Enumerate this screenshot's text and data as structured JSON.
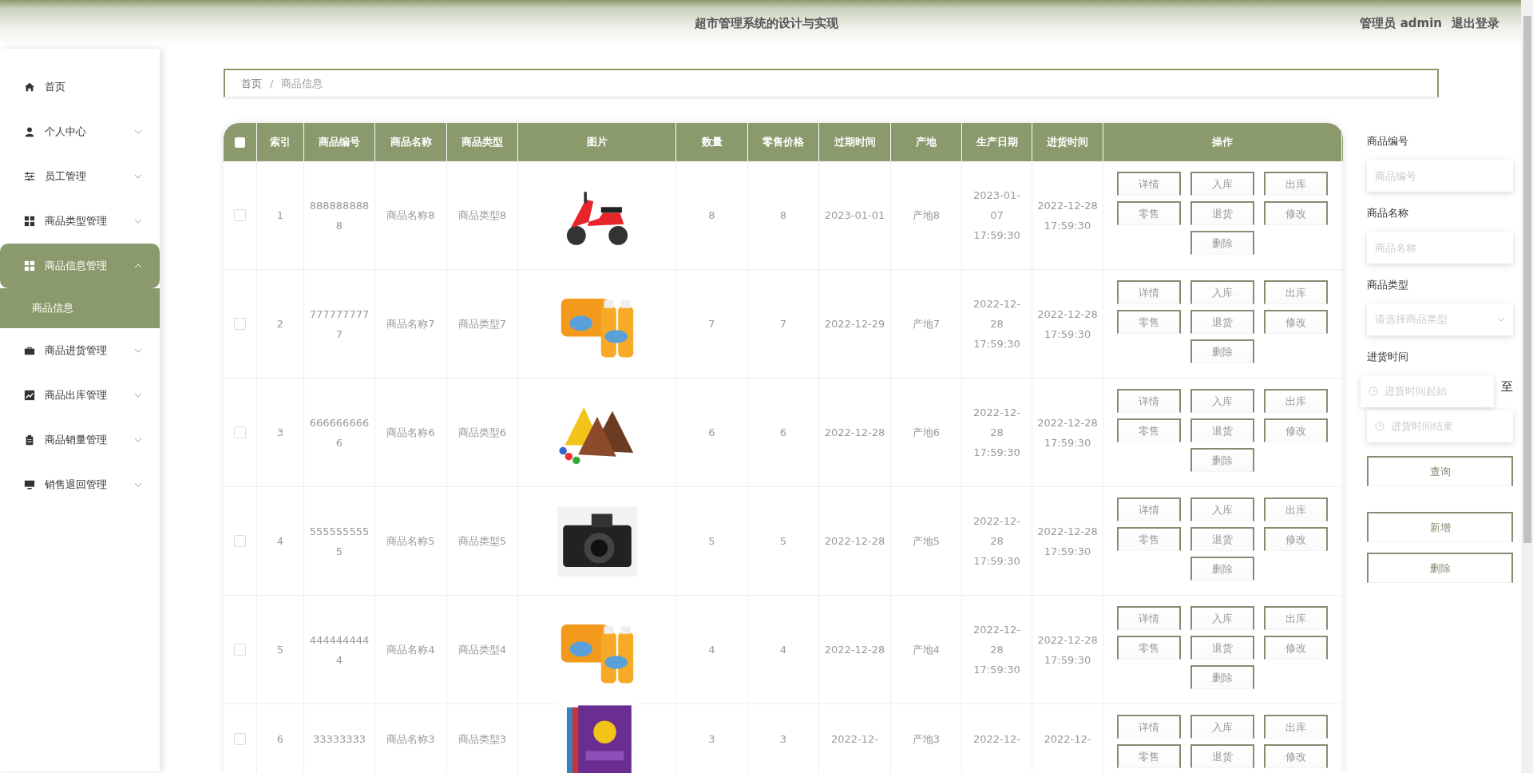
{
  "header": {
    "title": "超市管理系统的设计与实现",
    "user": "管理员 admin",
    "logout": "退出登录"
  },
  "sidebar": {
    "items": [
      {
        "label": "首页",
        "selected": false
      },
      {
        "label": "个人中心",
        "selected": false,
        "expanded": false
      },
      {
        "label": "员工管理",
        "selected": false,
        "expanded": false
      },
      {
        "label": "商品类型管理",
        "selected": false,
        "expanded": false
      },
      {
        "label": "商品信息管理",
        "selected": true,
        "expanded": true,
        "children": [
          {
            "label": "商品信息",
            "selected": true
          }
        ]
      },
      {
        "label": "商品进货管理",
        "selected": false,
        "expanded": false
      },
      {
        "label": "商品出库管理",
        "selected": false,
        "expanded": false
      },
      {
        "label": "商品销量管理",
        "selected": false,
        "expanded": false
      },
      {
        "label": "销售退回管理",
        "selected": false,
        "expanded": false
      }
    ]
  },
  "breadcrumb": {
    "items": [
      "首页",
      "商品信息"
    ],
    "separator": "/"
  },
  "table": {
    "select_all": {
      "checked": false
    },
    "columns": [
      "索引",
      "商品编号",
      "商品名称",
      "商品类型",
      "图片",
      "数量",
      "零售价格",
      "过期时间",
      "产地",
      "生产日期",
      "进货时间",
      "操作"
    ],
    "rows": [
      {
        "checked": false,
        "cells": [
          "1",
          "8888888888",
          "商品名称8",
          "商品类型8",
          "",
          "8",
          "8",
          "2023-01-01",
          "产地8",
          "2023-01-07 17:59:30",
          "2022-12-28 17:59:30"
        ],
        "actions": [
          "详情",
          "入库",
          "出库",
          "零售",
          "退货",
          "修改",
          "删除"
        ]
      },
      {
        "checked": false,
        "cells": [
          "2",
          "7777777777",
          "商品名称7",
          "商品类型7",
          "",
          "7",
          "7",
          "2022-12-29",
          "产地7",
          "2022-12-28 17:59:30",
          "2022-12-28 17:59:30"
        ],
        "actions": [
          "详情",
          "入库",
          "出库",
          "零售",
          "退货",
          "修改",
          "删除"
        ]
      },
      {
        "checked": false,
        "cells": [
          "3",
          "6666666666",
          "商品名称6",
          "商品类型6",
          "",
          "6",
          "6",
          "2022-12-28",
          "产地6",
          "2022-12-28 17:59:30",
          "2022-12-28 17:59:30"
        ],
        "actions": [
          "详情",
          "入库",
          "出库",
          "零售",
          "退货",
          "修改",
          "删除"
        ]
      },
      {
        "checked": false,
        "cells": [
          "4",
          "5555555555",
          "商品名称5",
          "商品类型5",
          "",
          "5",
          "5",
          "2022-12-28",
          "产地5",
          "2022-12-28 17:59:30",
          "2022-12-28 17:59:30"
        ],
        "actions": [
          "详情",
          "入库",
          "出库",
          "零售",
          "退货",
          "修改",
          "删除"
        ]
      },
      {
        "checked": false,
        "cells": [
          "5",
          "4444444444",
          "商品名称4",
          "商品类型4",
          "",
          "4",
          "4",
          "2022-12-28",
          "产地4",
          "2022-12-28 17:59:30",
          "2022-12-28 17:59:30"
        ],
        "actions": [
          "详情",
          "入库",
          "出库",
          "零售",
          "退货",
          "修改",
          "删除"
        ]
      },
      {
        "checked": false,
        "cells": [
          "6",
          "33333333",
          "商品名称3",
          "商品类型3",
          "",
          "3",
          "3",
          "2022-12-",
          "产地3",
          "2022-12-",
          "2022-12-"
        ],
        "actions": [
          "详情",
          "入库",
          "出库",
          "零售",
          "退货",
          "修改"
        ]
      }
    ]
  },
  "search": {
    "fields": [
      {
        "kind": "input",
        "label": "商品编号",
        "placeholder": "商品编号"
      },
      {
        "kind": "input",
        "label": "商品名称",
        "placeholder": "商品名称"
      },
      {
        "kind": "select",
        "label": "商品类型",
        "placeholder": "请选择商品类型"
      },
      {
        "kind": "daterange",
        "label": "进货时间",
        "start": "进货时间起始",
        "separator": "至",
        "end": "进货时间结束"
      }
    ],
    "buttons": [
      "查询",
      "新增",
      "删除"
    ]
  }
}
